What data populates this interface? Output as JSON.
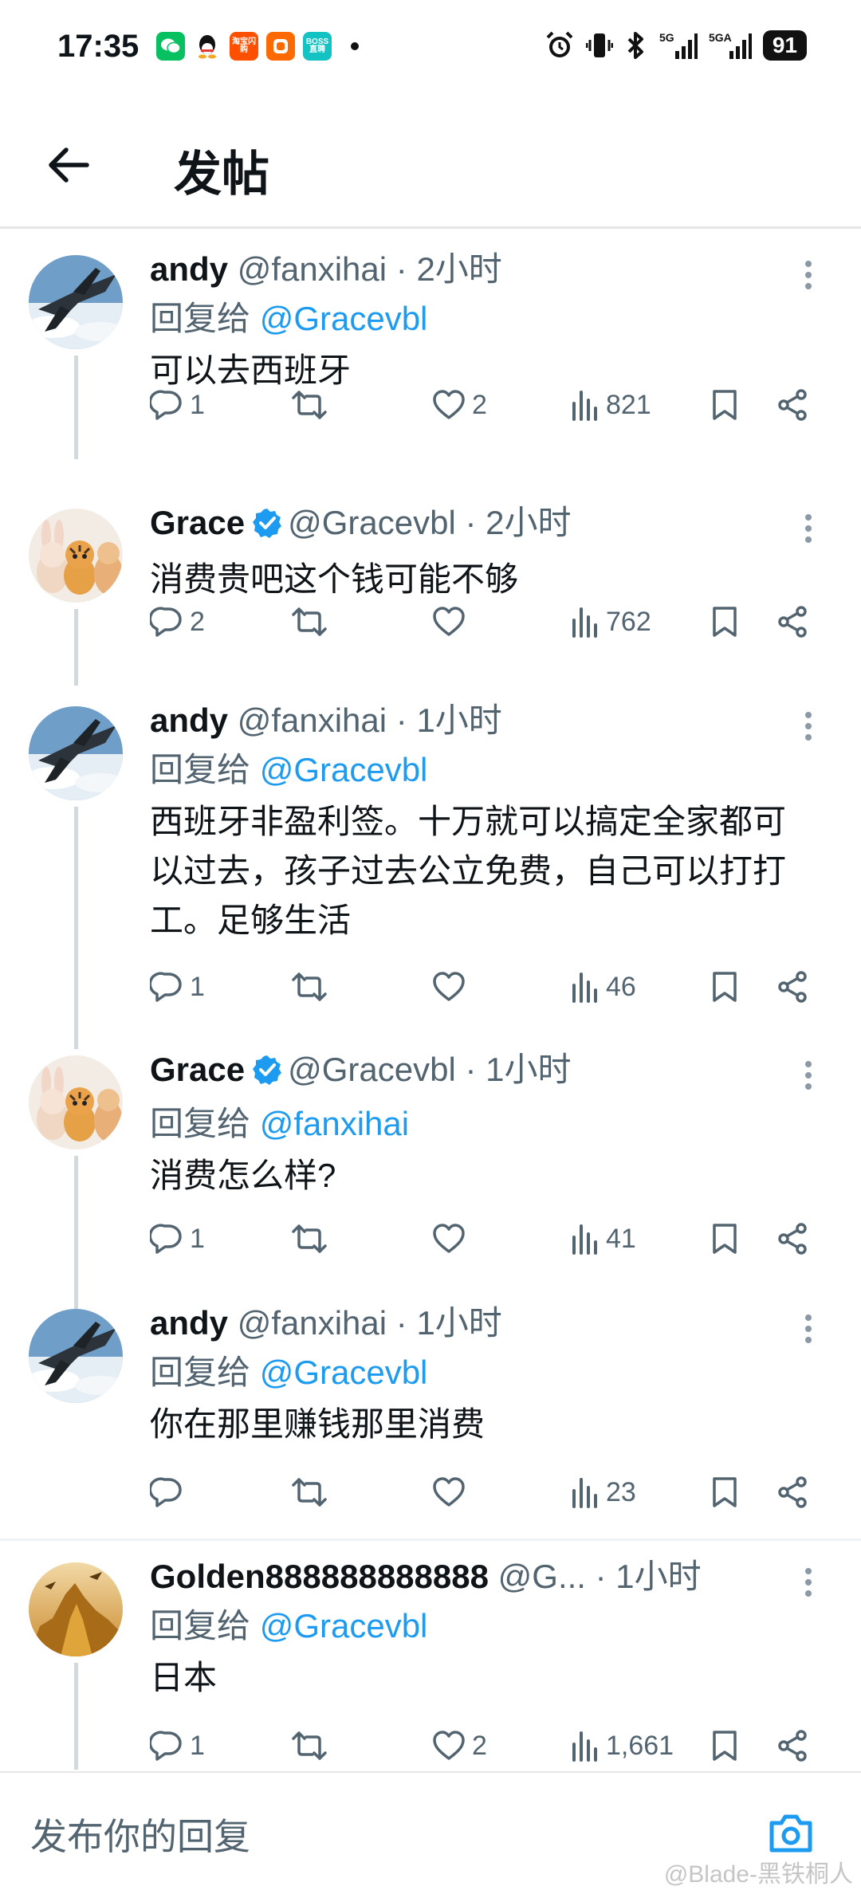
{
  "status_bar": {
    "time": "17:35",
    "apps": [
      {
        "name": "wechat",
        "color": "#07c160",
        "label": ""
      },
      {
        "name": "qq",
        "color": "#ffffff",
        "label": ""
      },
      {
        "name": "taobao-flash",
        "color": "#ff5000",
        "label": "淘宝闪购"
      },
      {
        "name": "app-orange",
        "color": "#ff6a00",
        "label": ""
      },
      {
        "name": "boss",
        "color": "#13c2c2",
        "label": "BOSS直聘"
      }
    ],
    "signal_5g": "5G",
    "signal_5ga": "5GA",
    "battery": "91"
  },
  "header": {
    "title": "发帖"
  },
  "posts": [
    {
      "name": "andy",
      "handle": "@fanxihai",
      "time": "2小时",
      "verified": false,
      "reply_prefix": "回复给",
      "reply_to": "@Gracevbl",
      "text": "可以去西班牙",
      "replies": "1",
      "likes": "2",
      "views": "821",
      "avatar": "jet"
    },
    {
      "name": "Grace",
      "handle": "@Gracevbl",
      "time": "2小时",
      "verified": true,
      "reply_prefix": "",
      "reply_to": "",
      "text": "消费贵吧这个钱可能不够",
      "replies": "2",
      "likes": "",
      "views": "762",
      "avatar": "plush"
    },
    {
      "name": "andy",
      "handle": "@fanxihai",
      "time": "1小时",
      "verified": false,
      "reply_prefix": "回复给",
      "reply_to": "@Gracevbl",
      "text": "西班牙非盈利签。十万就可以搞定全家都可以过去，孩子过去公立免费，自己可以打打工。足够生活",
      "replies": "1",
      "likes": "",
      "views": "46",
      "avatar": "jet"
    },
    {
      "name": "Grace",
      "handle": "@Gracevbl",
      "time": "1小时",
      "verified": true,
      "reply_prefix": "回复给",
      "reply_to": "@fanxihai",
      "text": "消费怎么样?",
      "replies": "1",
      "likes": "",
      "views": "41",
      "avatar": "plush"
    },
    {
      "name": "andy",
      "handle": "@fanxihai",
      "time": "1小时",
      "verified": false,
      "reply_prefix": "回复给",
      "reply_to": "@Gracevbl",
      "text": "你在那里赚钱那里消费",
      "replies": "",
      "likes": "",
      "views": "23",
      "avatar": "jet"
    },
    {
      "name": "Golden888888888888",
      "handle": "@G...",
      "time": "1小时",
      "verified": false,
      "reply_prefix": "回复给",
      "reply_to": "@Gracevbl",
      "text": "日本",
      "replies": "1",
      "likes": "2",
      "views": "1,661",
      "avatar": "golden"
    }
  ],
  "composer": {
    "placeholder": "发布你的回复"
  },
  "watermark": "@Blade-黑铁桐人",
  "colors": {
    "link": "#1d9bf0",
    "secondary_text": "#536471",
    "verified": "#1d9bf0"
  }
}
